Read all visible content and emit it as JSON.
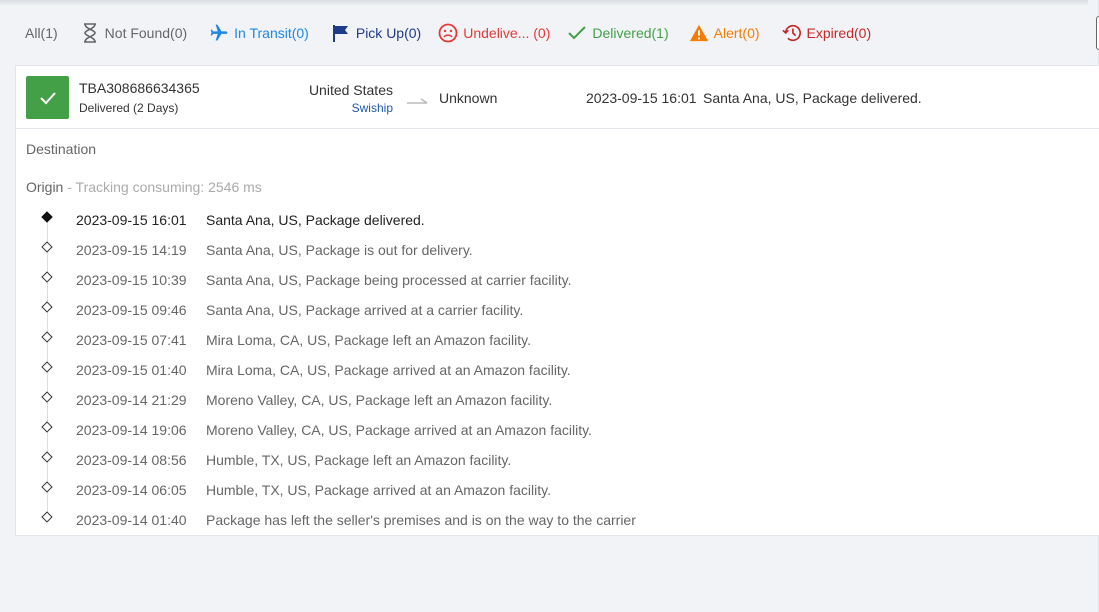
{
  "tabs": [
    {
      "label": "All(1)",
      "icon": "none",
      "color": "#666666"
    },
    {
      "label": "Not Found(0)",
      "icon": "hourglass-icon",
      "color": "#666666"
    },
    {
      "label": "In Transit(0)",
      "icon": "airplane-icon",
      "color": "#1e88e5"
    },
    {
      "label": "Pick Up(0)",
      "icon": "flag-icon",
      "color": "#1e3a8a"
    },
    {
      "label": "Undelive... (0)",
      "icon": "sad-face-icon",
      "color": "#e53935"
    },
    {
      "label": "Delivered(1)",
      "icon": "checkmark-icon",
      "color": "#43a047"
    },
    {
      "label": "Alert(0)",
      "icon": "warning-icon",
      "color": "#f57c00"
    },
    {
      "label": "Expired(0)",
      "icon": "history-icon",
      "color": "#c62828"
    }
  ],
  "package": {
    "tracking_number": "TBA308686634365",
    "status": "Delivered (2 Days)",
    "status_color": "#43a047",
    "origin_country": "United States",
    "carrier": "Swiship",
    "destination_country": "Unknown",
    "latest_time": "2023-09-15 16:01",
    "latest_event": "Santa Ana, US, Package delivered."
  },
  "details": {
    "destination_label": "Destination",
    "origin_label": "Origin",
    "tracking_meta": " - Tracking consuming: 2546 ms"
  },
  "events": [
    {
      "time": "2023-09-15 16:01",
      "desc": "Santa Ana, US, Package delivered."
    },
    {
      "time": "2023-09-15 14:19",
      "desc": "Santa Ana, US, Package is out for delivery."
    },
    {
      "time": "2023-09-15 10:39",
      "desc": "Santa Ana, US, Package being processed at carrier facility."
    },
    {
      "time": "2023-09-15 09:46",
      "desc": "Santa Ana, US, Package arrived at a carrier facility."
    },
    {
      "time": "2023-09-15 07:41",
      "desc": "Mira Loma, CA, US, Package left an Amazon facility."
    },
    {
      "time": "2023-09-15 01:40",
      "desc": "Mira Loma, CA, US, Package arrived at an Amazon facility."
    },
    {
      "time": "2023-09-14 21:29",
      "desc": "Moreno Valley, CA, US, Package left an Amazon facility."
    },
    {
      "time": "2023-09-14 19:06",
      "desc": "Moreno Valley, CA, US, Package arrived at an Amazon facility."
    },
    {
      "time": "2023-09-14 08:56",
      "desc": "Humble, TX, US, Package left an Amazon facility."
    },
    {
      "time": "2023-09-14 06:05",
      "desc": "Humble, TX, US, Package arrived at an Amazon facility."
    },
    {
      "time": "2023-09-14 01:40",
      "desc": "Package has left the seller's premises and is on the way to the carrier"
    }
  ]
}
